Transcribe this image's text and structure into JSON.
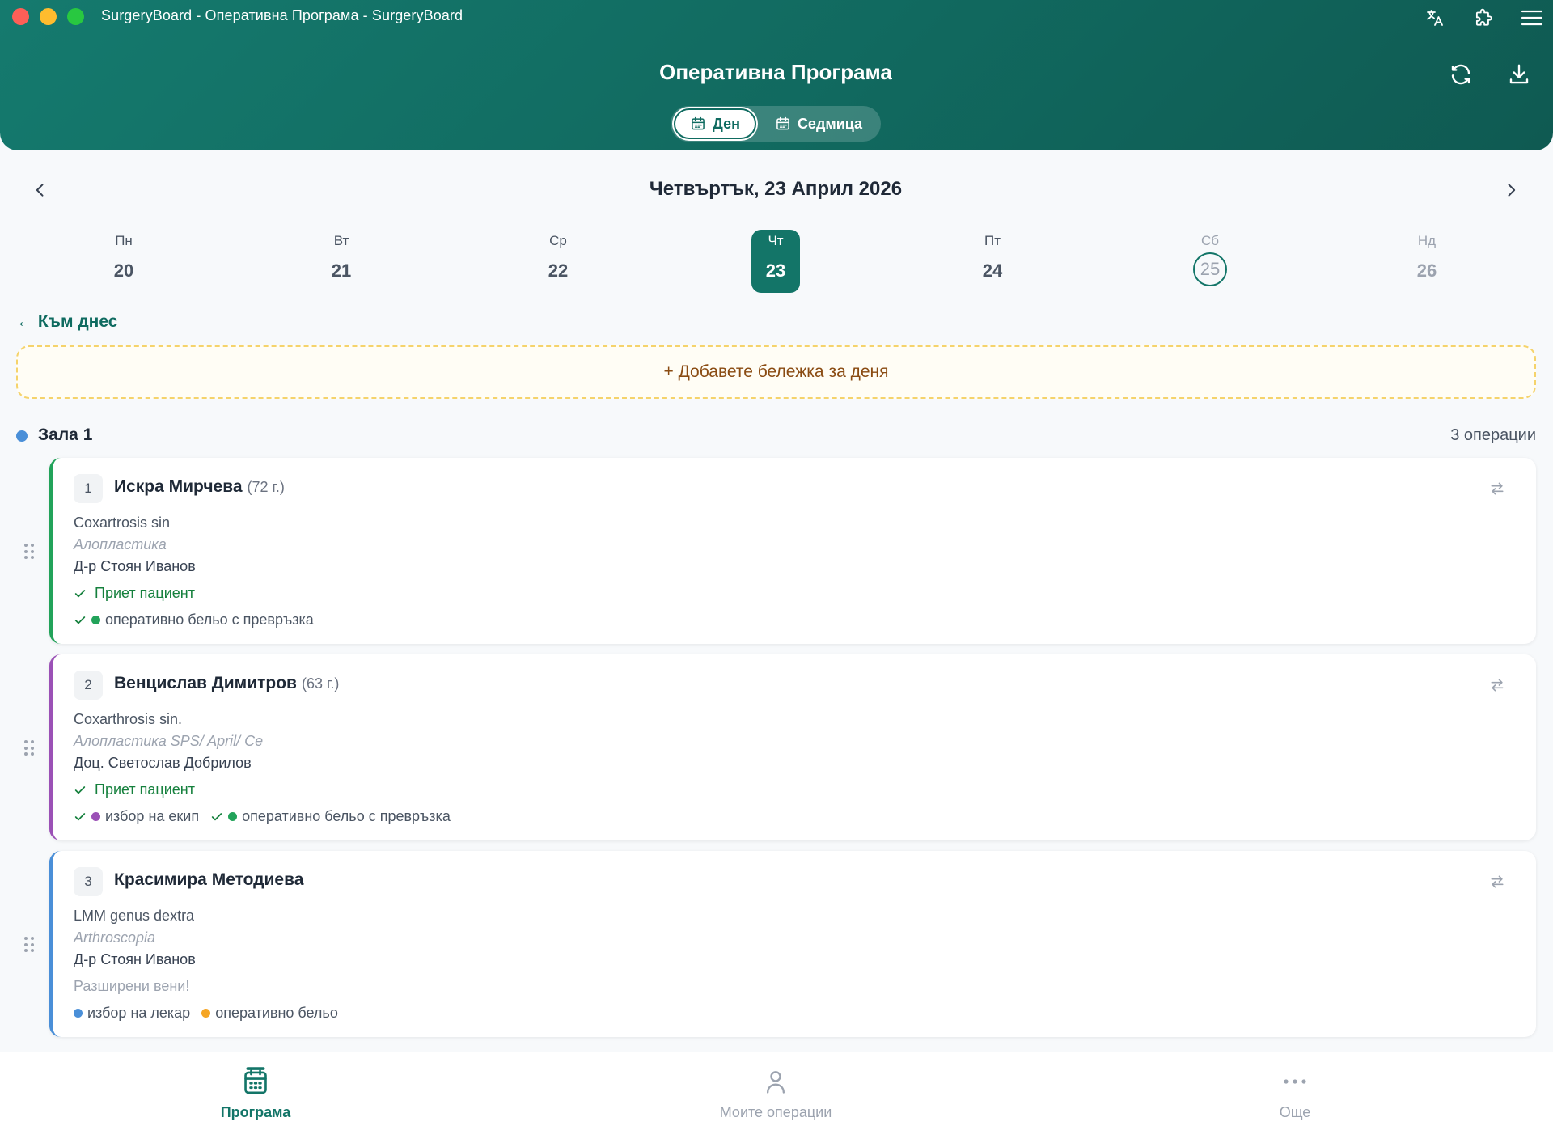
{
  "window": {
    "title": "SurgeryBoard - Оперативна Програма - SurgeryBoard"
  },
  "header": {
    "title": "Оперативна Програма",
    "view_day": "Ден",
    "view_week": "Седмица"
  },
  "date_nav": {
    "current": "Четвъртък, 23 Април 2026",
    "days": [
      {
        "name": "Пн",
        "date": "20"
      },
      {
        "name": "Вт",
        "date": "21"
      },
      {
        "name": "Ср",
        "date": "22"
      },
      {
        "name": "Чт",
        "date": "23"
      },
      {
        "name": "Пт",
        "date": "24"
      },
      {
        "name": "Сб",
        "date": "25"
      },
      {
        "name": "Нд",
        "date": "26"
      }
    ],
    "to_today": "← Към днес"
  },
  "note": {
    "add_label": "+ Добавете бележка за деня"
  },
  "room": {
    "name": "Зала 1",
    "count": "3 операции",
    "operations": [
      {
        "number": "1",
        "patient": "Искра Мирчева",
        "age": "(72 г.)",
        "diagnosis": "Coxartrosis sin",
        "procedure": "Алопластика",
        "doctor": "Д-р Стоян Иванов",
        "status": "Приет пациент",
        "tags": [
          {
            "label": "оперативно бельо с превръзка",
            "color": "#22a35a"
          }
        ]
      },
      {
        "number": "2",
        "patient": "Венцислав Димитров",
        "age": "(63 г.)",
        "diagnosis": "Coxarthrosis sin.",
        "procedure": "Алопластика SPS/ April/ Ce",
        "doctor": "Доц. Светослав Добрилов",
        "status": "Приет пациент",
        "tags": [
          {
            "label": "избор на екип",
            "color": "#9b51b6"
          },
          {
            "label": "оперативно бельо с превръзка",
            "color": "#22a35a"
          }
        ]
      },
      {
        "number": "3",
        "patient": "Красимира Методиева",
        "age": "",
        "diagnosis": "LMM genus dextra",
        "procedure": "Arthroscopia",
        "doctor": "Д-р Стоян Иванов",
        "note": "Разширени вени!",
        "tags": [
          {
            "label": "избор на лекар",
            "color": "#4a8fd8"
          },
          {
            "label": "оперативно бельо",
            "color": "#f5a524"
          }
        ]
      }
    ]
  },
  "bottom_nav": {
    "program": "Програма",
    "my_operations": "Моите операции",
    "more": "Още"
  },
  "colors": {
    "brand": "#137568",
    "accepted": "#15803d",
    "note_border": "#f5d36b"
  }
}
